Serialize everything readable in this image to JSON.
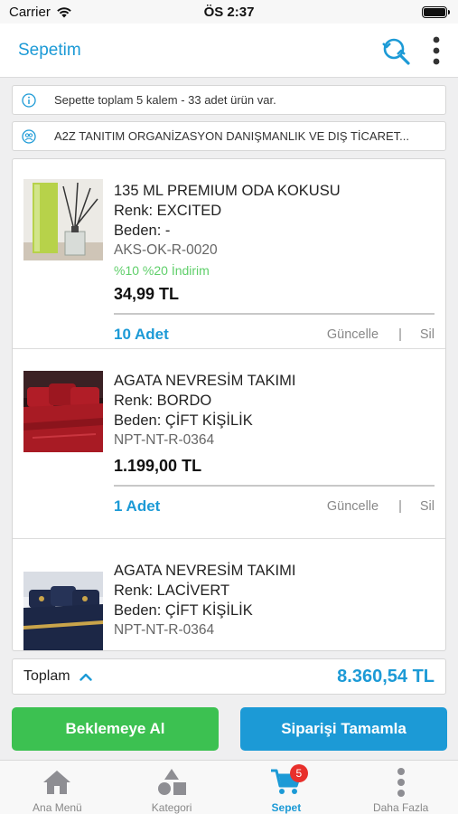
{
  "status_bar": {
    "carrier": "Carrier",
    "time": "ÖS 2:37"
  },
  "header": {
    "title": "Sepetim"
  },
  "info": {
    "summary": "Sepette toplam 5 kalem - 33 adet ürün var.",
    "company": "A2Z TANITIM ORGANİZASYON DANIŞMANLIK VE DIŞ TİCARET..."
  },
  "items": [
    {
      "name": "135 ML PREMIUM ODA KOKUSU",
      "color": "Renk: EXCITED",
      "size": "Beden: -",
      "code": "AKS-OK-R-0020",
      "discount": "%10 %20  İndirim",
      "price": "34,99 TL",
      "qty": "10 Adet",
      "update": "Güncelle",
      "sep": "|",
      "delete": "Sil"
    },
    {
      "name": "AGATA NEVRESİM TAKIMI",
      "color": "Renk: BORDO",
      "size": "Beden: ÇİFT KİŞİLİK",
      "code": "NPT-NT-R-0364",
      "price": "1.199,00 TL",
      "qty": "1 Adet",
      "update": "Güncelle",
      "sep": "|",
      "delete": "Sil"
    },
    {
      "name": "AGATA NEVRESİM TAKIMI",
      "color": "Renk: LACİVERT",
      "size": "Beden: ÇİFT KİŞİLİK",
      "code": "NPT-NT-R-0364"
    }
  ],
  "total": {
    "label": "Toplam",
    "value": "8.360,54 TL"
  },
  "buttons": {
    "hold": "Beklemeye Al",
    "complete": "Siparişi Tamamla"
  },
  "nav": [
    {
      "label": "Ana Menü",
      "icon": "home-icon"
    },
    {
      "label": "Kategori",
      "icon": "category-icon"
    },
    {
      "label": "Sepet",
      "icon": "cart-icon",
      "badge": "5",
      "active": true
    },
    {
      "label": "Daha Fazla",
      "icon": "more-icon"
    }
  ],
  "colors": {
    "accent": "#1c9ad6",
    "green": "#3cc151",
    "discount": "#5fcf6a",
    "badge": "#e8302c"
  }
}
